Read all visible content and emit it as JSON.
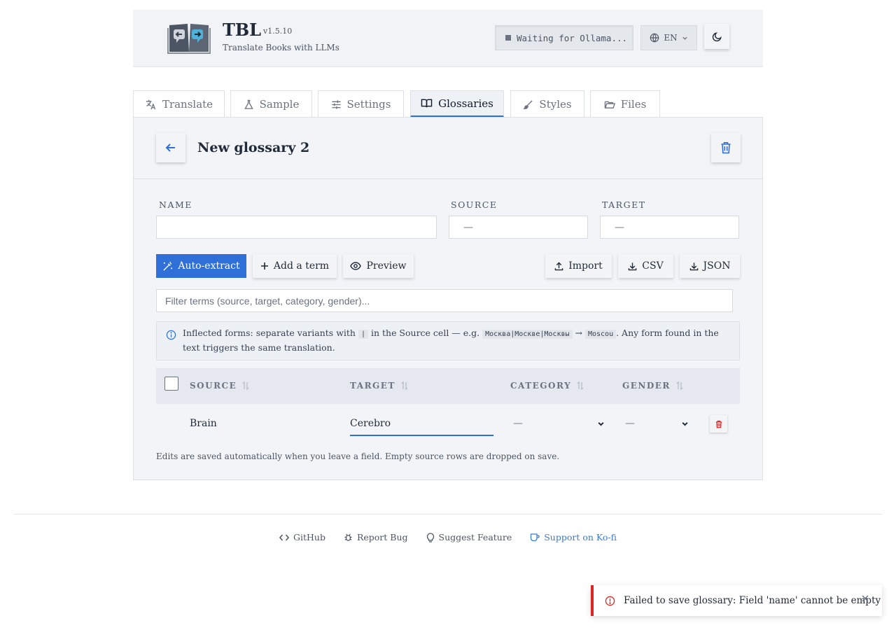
{
  "header": {
    "title": "TBL",
    "version": "v1.5.10",
    "subtitle": "Translate Books with LLMs",
    "status": "Waiting for Ollama...",
    "language": "EN"
  },
  "tabs": [
    {
      "label": "Translate",
      "icon": "translate-icon"
    },
    {
      "label": "Sample",
      "icon": "flask-icon"
    },
    {
      "label": "Settings",
      "icon": "sliders-icon"
    },
    {
      "label": "Glossaries",
      "icon": "book-open-icon",
      "active": true
    },
    {
      "label": "Styles",
      "icon": "brush-icon"
    },
    {
      "label": "Files",
      "icon": "folder-icon"
    }
  ],
  "glossary": {
    "title": "New glossary 2",
    "fields": {
      "name_label": "NAME",
      "name_value": "",
      "source_label": "SOURCE",
      "source_value": "—",
      "target_label": "TARGET",
      "target_value": "—"
    },
    "buttons": {
      "auto_extract": "Auto-extract",
      "add_term": "Add a term",
      "preview": "Preview",
      "import": "Import",
      "csv": "CSV",
      "json": "JSON"
    },
    "filter_placeholder": "Filter terms (source, target, category, gender)...",
    "info": {
      "part1": "Inflected forms: separate variants with",
      "sep": "|",
      "part2": "in the Source cell — e.g.",
      "example": "Москва|Москве|Москвы",
      "arrow": "→",
      "result": "Moscou",
      "part3": ". Any form found in the text triggers the same translation."
    },
    "table": {
      "headers": [
        "SOURCE",
        "TARGET",
        "CATEGORY",
        "GENDER"
      ],
      "rows": [
        {
          "source": "Brain",
          "target": "Cerebro",
          "category": "—",
          "gender": "—"
        }
      ]
    },
    "note": "Edits are saved automatically when you leave a field. Empty source rows are dropped on save."
  },
  "footer": {
    "links": [
      {
        "label": "GitHub",
        "icon": "code-icon"
      },
      {
        "label": "Report Bug",
        "icon": "bug-icon"
      },
      {
        "label": "Suggest Feature",
        "icon": "lightbulb-icon"
      },
      {
        "label": "Support on Ko-fi",
        "icon": "coffee-icon"
      }
    ]
  },
  "toast": {
    "message": "Failed to save glossary: Field 'name' cannot be empty",
    "type": "error"
  },
  "colors": {
    "accent": "#2f6fd8",
    "error": "#dc2626",
    "kofi": "#3a7bd5"
  }
}
